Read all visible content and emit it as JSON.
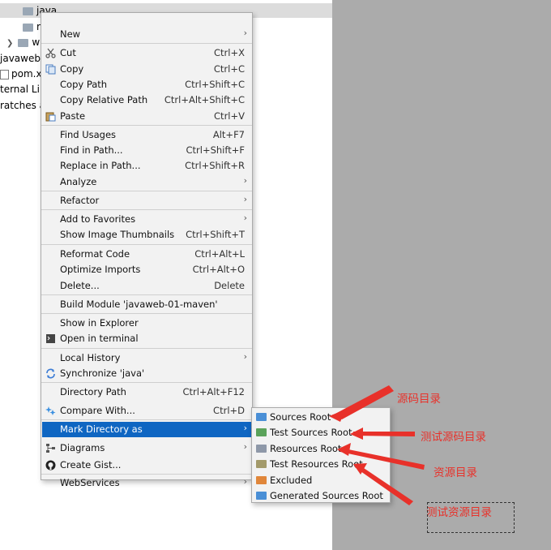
{
  "tree": {
    "rows": [
      "java",
      "re",
      "w",
      "javaweb",
      "pom.xm",
      "ternal Lib",
      "ratches a"
    ]
  },
  "menu": {
    "items": [
      {
        "label": "New",
        "shortcut": "",
        "submenu": true
      },
      {
        "label": "Cut",
        "shortcut": "Ctrl+X",
        "icon": "scissors-icon"
      },
      {
        "label": "Copy",
        "shortcut": "Ctrl+C",
        "icon": "copy-icon"
      },
      {
        "label": "Copy Path",
        "shortcut": "Ctrl+Shift+C"
      },
      {
        "label": "Copy Relative Path",
        "shortcut": "Ctrl+Alt+Shift+C"
      },
      {
        "label": "Paste",
        "shortcut": "Ctrl+V",
        "icon": "paste-icon"
      },
      {
        "label": "Find Usages",
        "shortcut": "Alt+F7"
      },
      {
        "label": "Find in Path...",
        "shortcut": "Ctrl+Shift+F"
      },
      {
        "label": "Replace in Path...",
        "shortcut": "Ctrl+Shift+R"
      },
      {
        "label": "Analyze",
        "shortcut": "",
        "submenu": true
      },
      {
        "label": "Refactor",
        "shortcut": "",
        "submenu": true
      },
      {
        "label": "Add to Favorites",
        "shortcut": "",
        "submenu": true
      },
      {
        "label": "Show Image Thumbnails",
        "shortcut": "Ctrl+Shift+T"
      },
      {
        "label": "Reformat Code",
        "shortcut": "Ctrl+Alt+L"
      },
      {
        "label": "Optimize Imports",
        "shortcut": "Ctrl+Alt+O"
      },
      {
        "label": "Delete...",
        "shortcut": "Delete"
      },
      {
        "label": "Build Module 'javaweb-01-maven'",
        "shortcut": ""
      },
      {
        "label": "Show in Explorer",
        "shortcut": ""
      },
      {
        "label": "Open in terminal",
        "shortcut": "",
        "icon": "terminal-icon"
      },
      {
        "label": "Local History",
        "shortcut": "",
        "submenu": true
      },
      {
        "label": "Synchronize 'java'",
        "shortcut": "",
        "icon": "sync-icon"
      },
      {
        "label": "Directory Path",
        "shortcut": "Ctrl+Alt+F12"
      },
      {
        "label": "Compare With...",
        "shortcut": "Ctrl+D",
        "icon": "compare-icon"
      },
      {
        "label": "Mark Directory as",
        "shortcut": "",
        "submenu": true,
        "selected": true
      },
      {
        "label": "Diagrams",
        "shortcut": "",
        "submenu": true,
        "icon": "diagram-icon"
      },
      {
        "label": "Create Gist...",
        "shortcut": "",
        "icon": "github-icon"
      },
      {
        "label": "WebServices",
        "shortcut": "",
        "submenu": true
      }
    ]
  },
  "submenu": {
    "items": [
      {
        "label": "Sources Root",
        "color": "#4a8fd6"
      },
      {
        "label": "Test Sources Root",
        "color": "#5aa25a"
      },
      {
        "label": "Resources Root",
        "color": "#8e98a8"
      },
      {
        "label": "Test Resources Root",
        "color": "#a39a6a"
      },
      {
        "label": "Excluded",
        "color": "#e0863a"
      },
      {
        "label": "Generated Sources Root",
        "color": "#4a8fd6"
      }
    ]
  },
  "annotations": [
    "源码目录",
    "测试源码目录",
    "资源目录",
    "测试资源目录"
  ],
  "colors": {
    "selection": "#0f66c2",
    "annotation": "#e8312a",
    "menu_bg": "#f2f2f2",
    "right_pane": "#ababab"
  }
}
